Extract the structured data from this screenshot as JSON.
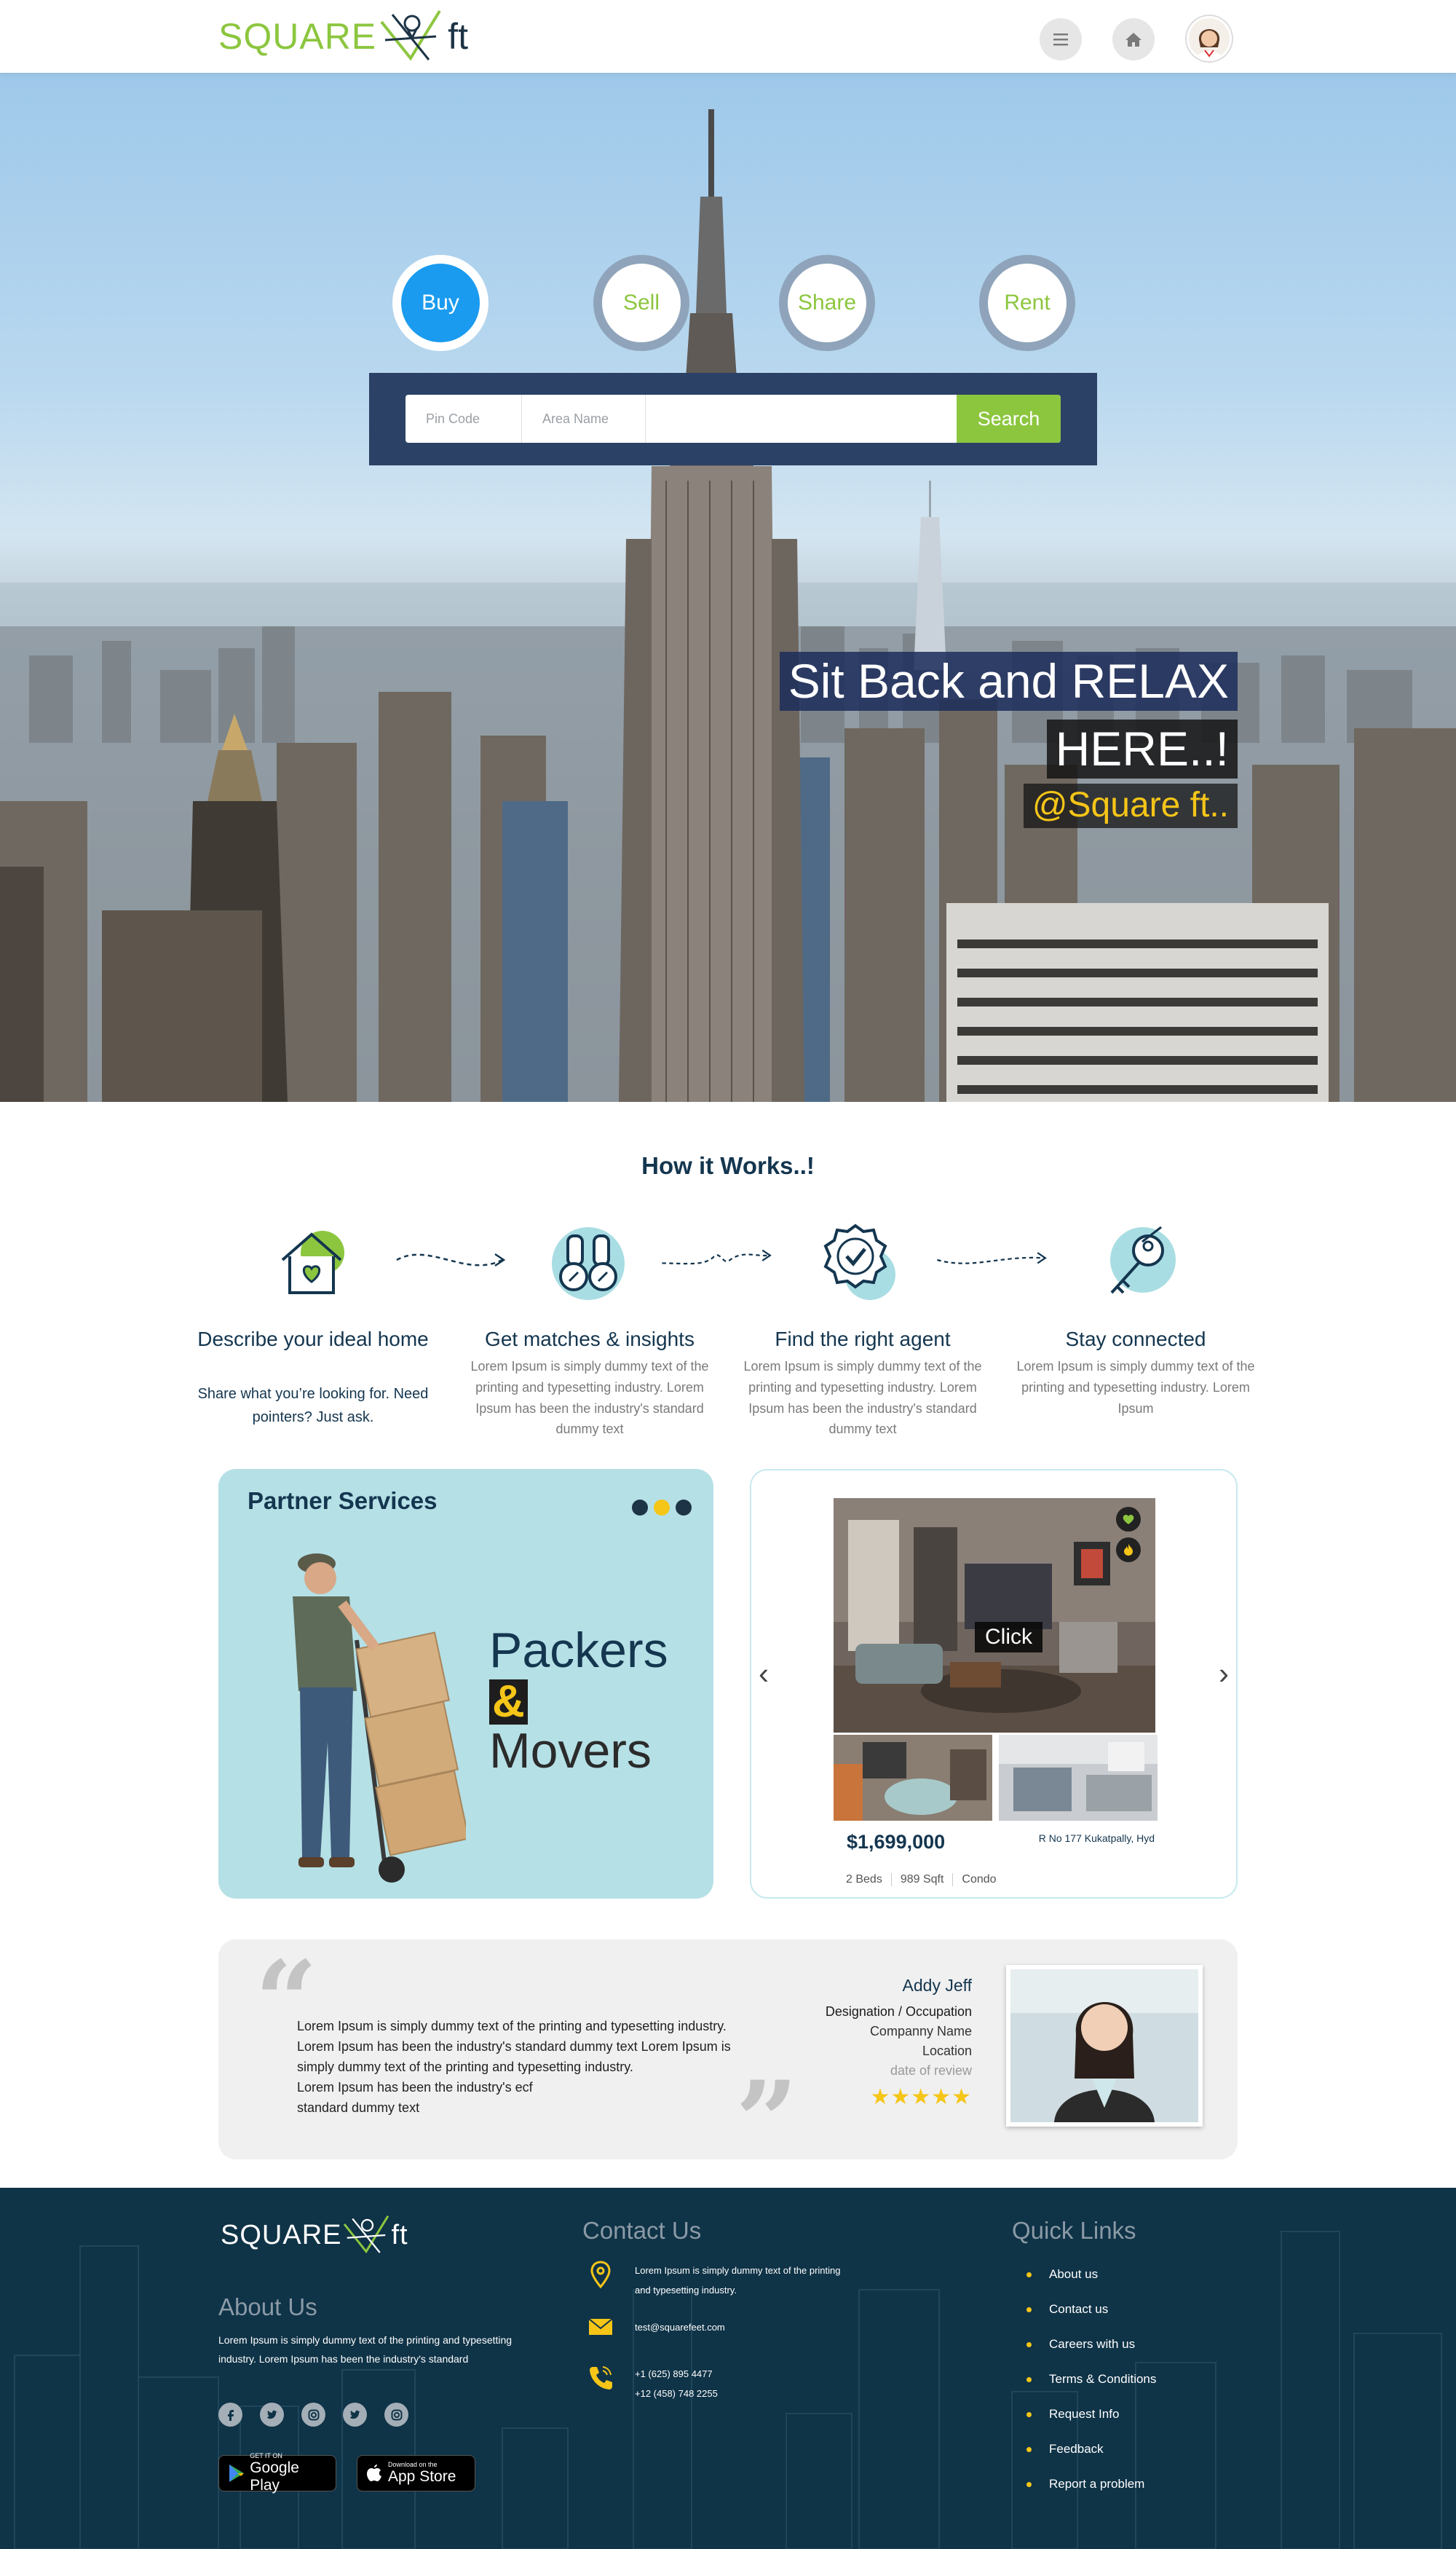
{
  "header": {
    "logo_word": "SQUARE",
    "logo_suffix": "ft",
    "menu_icon": "hamburger-icon",
    "home_icon": "home-icon",
    "avatar_icon": "user-avatar"
  },
  "hero": {
    "modes": [
      {
        "label": "Buy",
        "active": true
      },
      {
        "label": "Sell",
        "active": false
      },
      {
        "label": "Share",
        "active": false
      },
      {
        "label": "Rent",
        "active": false
      }
    ],
    "search": {
      "pin_placeholder": "Pin Code",
      "area_placeholder": "Area Name",
      "button": "Search"
    },
    "tagline": {
      "line1": "Sit Back and RELAX",
      "line2": "HERE..!",
      "line3": "@Square ft.."
    }
  },
  "how": {
    "title": "How it Works..!",
    "steps": [
      {
        "icon": "house-heart-icon",
        "title": "Describe your ideal home",
        "desc": "Share what you’re looking for. Need pointers? Just ask."
      },
      {
        "icon": "binoculars-icon",
        "title": "Get matches & insights",
        "desc": "Lorem Ipsum is simply dummy text of the printing and typesetting industry. Lorem Ipsum has been the industry's standard dummy text"
      },
      {
        "icon": "badge-check-icon",
        "title": "Find the right agent",
        "desc": "Lorem Ipsum is simply dummy text of the printing and typesetting industry. Lorem Ipsum has been the industry's standard dummy text"
      },
      {
        "icon": "key-icon",
        "title": "Stay connected",
        "desc": "Lorem Ipsum is simply dummy text of the printing and typesetting industry. Lorem Ipsum"
      }
    ]
  },
  "partner": {
    "title": "Partner Services",
    "line1": "Packers",
    "amp": "&",
    "line2": "Movers",
    "dots_active_index": 1
  },
  "listing": {
    "click_label": "Click",
    "price": "$1,699,000",
    "address": "R No 177 Kukatpally, Hyd",
    "beds": "2 Beds",
    "sqft": "989 Sqft",
    "type": "Condo"
  },
  "testimonial": {
    "text_lines": [
      "Lorem Ipsum is simply dummy text of the printing and typesetting industry.",
      "Lorem Ipsum has been the industry's  standard dummy text Lorem Ipsum is",
      "simply dummy text of the printing and typesetting industry.",
      "Lorem Ipsum has been the industry's ecf",
      "standard dummy text"
    ],
    "name": "Addy Jeff",
    "designation": "Designation / Occupation",
    "company": "Companny Name",
    "location": "Location",
    "date": "date of review",
    "stars": "★★★★★"
  },
  "footer": {
    "logo_word": "SQUARE",
    "logo_suffix": "ft",
    "about_title": "About Us",
    "about_text": "Lorem Ipsum is simply dummy text of the printing and typesetting industry. Lorem Ipsum has been the industry's standard",
    "socials": [
      "facebook-icon",
      "twitter-icon",
      "instagram-icon",
      "twitter-icon",
      "instagram-icon"
    ],
    "google_play_small": "GET IT ON",
    "google_play": "Google Play",
    "app_store_small": "Download on the",
    "app_store": "App Store",
    "contact_title": "Contact Us",
    "address_line1": "Lorem Ipsum is simply dummy text of the printing",
    "address_line2": "and typesetting industry.",
    "email": "test@squarefeet.com",
    "phone1": "+1 (625) 895 4477",
    "phone2": "+12 (458) 748 2255",
    "quick_title": "Quick Links",
    "links": [
      "About us",
      "Contact us",
      "Careers with us",
      "Terms & Conditions",
      "Request Info",
      "Feedback",
      "Report a problem"
    ]
  },
  "colors": {
    "brand_green": "#8cc63f",
    "navy": "#14364f",
    "accent_blue": "#1a9bef",
    "star_yellow": "#f5c518",
    "footer_bg": "#0f3347"
  }
}
